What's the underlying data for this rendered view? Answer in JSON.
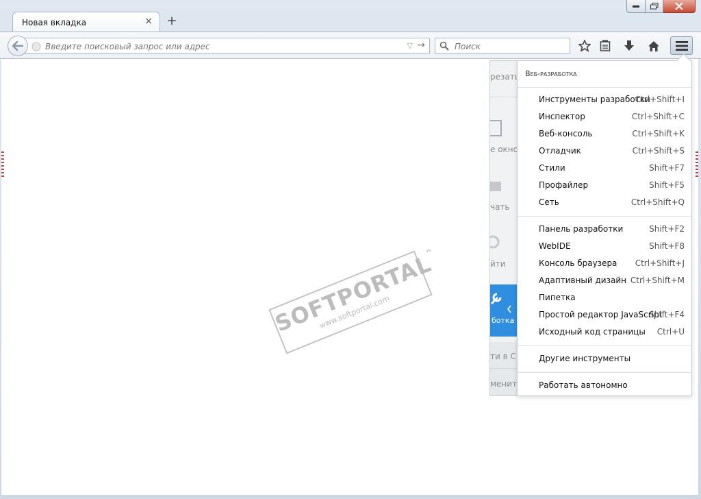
{
  "tab": {
    "title": "Новая вкладка",
    "close": "×",
    "new_tab": "+"
  },
  "urlbar": {
    "placeholder": "Введите поисковый запрос или адрес"
  },
  "search": {
    "placeholder": "Поиск"
  },
  "toolbar_icons": [
    "star-icon",
    "reading-list-icon",
    "download-icon",
    "home-icon",
    "menu-icon"
  ],
  "panel_fragments": {
    "cut": "резать",
    "window": "е окно",
    "print": "чать",
    "find": "йти",
    "developer": "ботка",
    "sync": "ти в Си",
    "customize": "менить"
  },
  "devmenu": {
    "header": "Веб-разработка",
    "items": [
      {
        "label": "Инструменты разработки",
        "shortcut": "Ctrl+Shift+I"
      },
      {
        "label": "Инспектор",
        "shortcut": "Ctrl+Shift+C"
      },
      {
        "label": "Веб-консоль",
        "shortcut": "Ctrl+Shift+K"
      },
      {
        "label": "Отладчик",
        "shortcut": "Ctrl+Shift+S"
      },
      {
        "label": "Стили",
        "shortcut": "Shift+F7"
      },
      {
        "label": "Профайлер",
        "shortcut": "Shift+F5"
      },
      {
        "label": "Сеть",
        "shortcut": "Ctrl+Shift+Q"
      },
      {
        "label": "Панель разработки",
        "shortcut": "Shift+F2"
      },
      {
        "label": "WebIDE",
        "shortcut": "Shift+F8"
      },
      {
        "label": "Консоль браузера",
        "shortcut": "Ctrl+Shift+J"
      },
      {
        "label": "Адаптивный дизайн",
        "shortcut": "Ctrl+Shift+M"
      },
      {
        "label": "Пипетка",
        "shortcut": ""
      },
      {
        "label": "Простой редактор JavaScript",
        "shortcut": "Shift+F4"
      },
      {
        "label": "Исходный код страницы",
        "shortcut": "Ctrl+U"
      },
      {
        "label": "Другие инструменты",
        "shortcut": ""
      },
      {
        "label": "Работать автономно",
        "shortcut": ""
      }
    ]
  },
  "watermark": {
    "brand": "SOFTPORTAL",
    "url": "www.softportal.com",
    "tm": "™"
  },
  "colors": {
    "accent": "#2f8ee0",
    "close_button": "#c74a34"
  }
}
